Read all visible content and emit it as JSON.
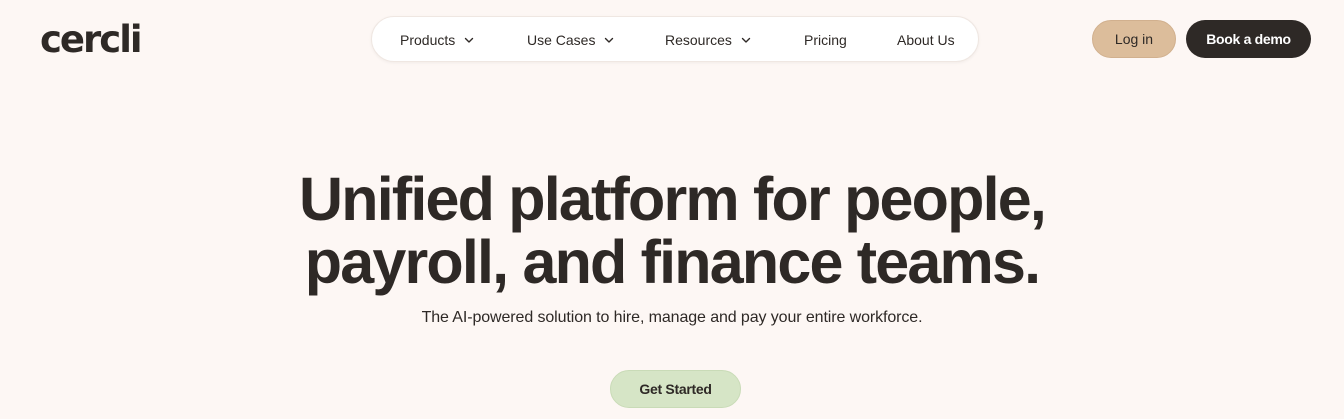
{
  "brand": {
    "logo_text": "cercli"
  },
  "nav": {
    "items": [
      {
        "label": "Products",
        "has_dropdown": true
      },
      {
        "label": "Use Cases",
        "has_dropdown": true
      },
      {
        "label": "Resources",
        "has_dropdown": true
      },
      {
        "label": "Pricing",
        "has_dropdown": false
      },
      {
        "label": "About Us",
        "has_dropdown": false
      }
    ]
  },
  "header_actions": {
    "login_label": "Log in",
    "demo_label": "Book a demo"
  },
  "hero": {
    "title_line1": "Unified platform for people,",
    "title_line2": "payroll, and finance teams.",
    "subtitle": "The AI-powered solution to hire, manage and pay your entire workforce.",
    "cta_label": "Get Started"
  },
  "colors": {
    "background": "#fdf7f4",
    "text": "#2e2926",
    "login_bg": "#dcbd9b",
    "demo_bg": "#2e2926",
    "cta_bg": "#d6e5c6"
  },
  "icons": {
    "dropdown": "chevron-down-icon"
  }
}
